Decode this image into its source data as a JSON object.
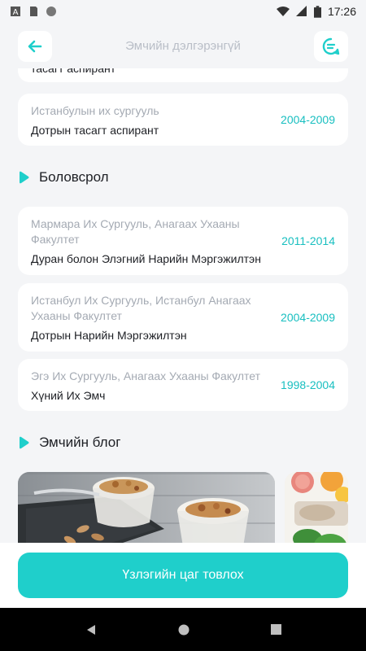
{
  "status_bar": {
    "time": "17:26",
    "icons": [
      "a-icon",
      "sd-card-icon",
      "circle-icon",
      "wifi-icon",
      "signal-icon",
      "battery-icon"
    ]
  },
  "header": {
    "title": "Эмчийн дэлгэрэнгүй",
    "back_icon": "arrow-left-icon",
    "chat_icon": "chat-bubble-icon"
  },
  "experience": {
    "partial_card_main": "тасагт аспирант",
    "card": {
      "sub": "Истанбулын их сургууль",
      "main": "Дотрын тасагт аспирант",
      "years": "2004-2009"
    }
  },
  "education": {
    "title": "Боловсрол",
    "items": [
      {
        "sub": "Мармара Их Сургууль, Анагаах Ухааны Факултет",
        "main": "Дуран болон Элэгний Нарийн Мэргэжилтэн",
        "years": "2011-2014"
      },
      {
        "sub": "Истанбул Их Сургууль, Истанбул Анагаах Ухааны Факултет",
        "main": "Дотрын Нарийн Мэргэжилтэн",
        "years": "2004-2009"
      },
      {
        "sub": "Эгэ Их Сургууль, Анагаах Ухааны Факултет",
        "main": "Хүний Их Эмч",
        "years": "1998-2004"
      }
    ]
  },
  "blog": {
    "title": "Эмчийн блог",
    "images": [
      "yogurt-granola-photo",
      "fruit-salad-photo"
    ]
  },
  "cta": {
    "label": "Үзлэгийн цаг товлох"
  },
  "colors": {
    "accent": "#1fcfcb",
    "years": "#18bfc0",
    "background": "#f4f5f7"
  }
}
